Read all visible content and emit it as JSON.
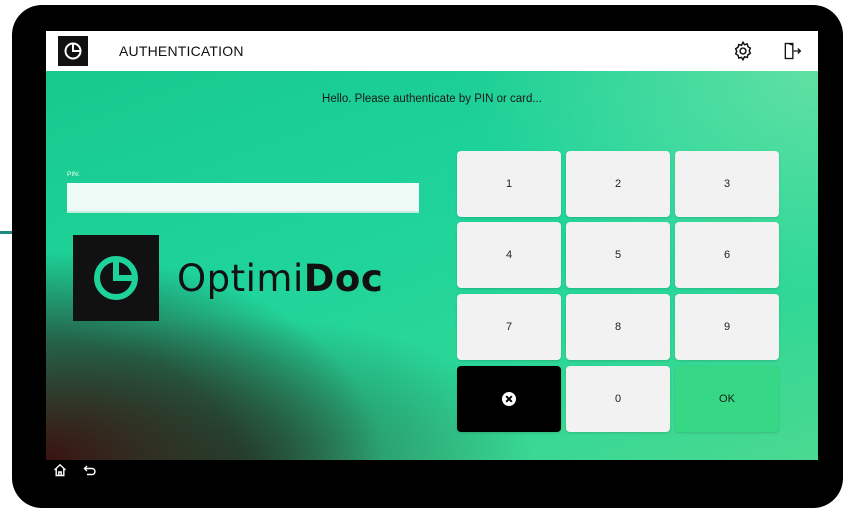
{
  "header": {
    "title": "AUTHENTICATION"
  },
  "greeting": "Hello. Please authenticate by PIN or card...",
  "pin": {
    "label": "PIN:",
    "value": "",
    "placeholder": ""
  },
  "brand": {
    "name_regular": "Optimi",
    "name_bold": "Doc"
  },
  "keypad": {
    "keys": [
      "1",
      "2",
      "3",
      "4",
      "5",
      "6",
      "7",
      "8",
      "9"
    ],
    "zero": "0",
    "ok": "OK",
    "clear_icon": "clear-circle-x-icon"
  },
  "icons": {
    "app": "optimidoc-logo-icon",
    "settings": "gear-icon",
    "logout": "logout-door-icon",
    "home": "home-icon",
    "back": "back-arrow-icon"
  },
  "colors": {
    "ok_key": "#36d885",
    "clear_key": "#000000",
    "background_accent": "#1ed39a"
  }
}
